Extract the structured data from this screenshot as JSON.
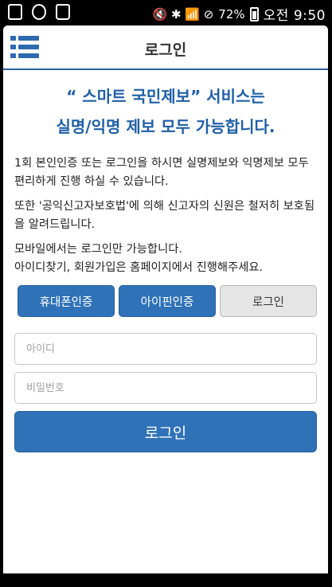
{
  "status_bar": {
    "left_icons": [
      "gallery-icon",
      "sync-icon",
      "shopping-bag-icon"
    ],
    "signal_symbols": "🔇 ✱ 📶 ⊘",
    "battery_percent": "72%",
    "time": "오전 9:50"
  },
  "app_bar": {
    "title": "로그인",
    "menu_icon": "hamburger-menu-icon",
    "accent": "#2d6aae"
  },
  "headline": {
    "line1": "“ 스마트 국민제보” 서비스는",
    "line2": "실명/익명 제보 모두 가능합니다."
  },
  "description": {
    "para1": "1회 본인인증 또는 로그인을 하시면 실명제보와 익명제보 모두 편리하게 진행 하실 수 있습니다.",
    "para2": "또한 '공익신고자보호법'에 의해 신고자의 신원은 철저히 보호됨을 알려드립니다.",
    "para3": "모바일에서는 로그인만 가능합니다.",
    "para4": "아이디찾기, 회원가입은 홈페이지에서 진행해주세요."
  },
  "tabs": {
    "phone_auth": "휴대폰인증",
    "ipin_auth": "아이핀인증",
    "login": "로그인"
  },
  "form": {
    "id_placeholder": "아이디",
    "password_placeholder": "비밀번호",
    "submit_label": "로그인"
  },
  "colors": {
    "primary": "#2f72b8",
    "headline": "#1f5fa6",
    "secondary": "#e6e6e6"
  }
}
